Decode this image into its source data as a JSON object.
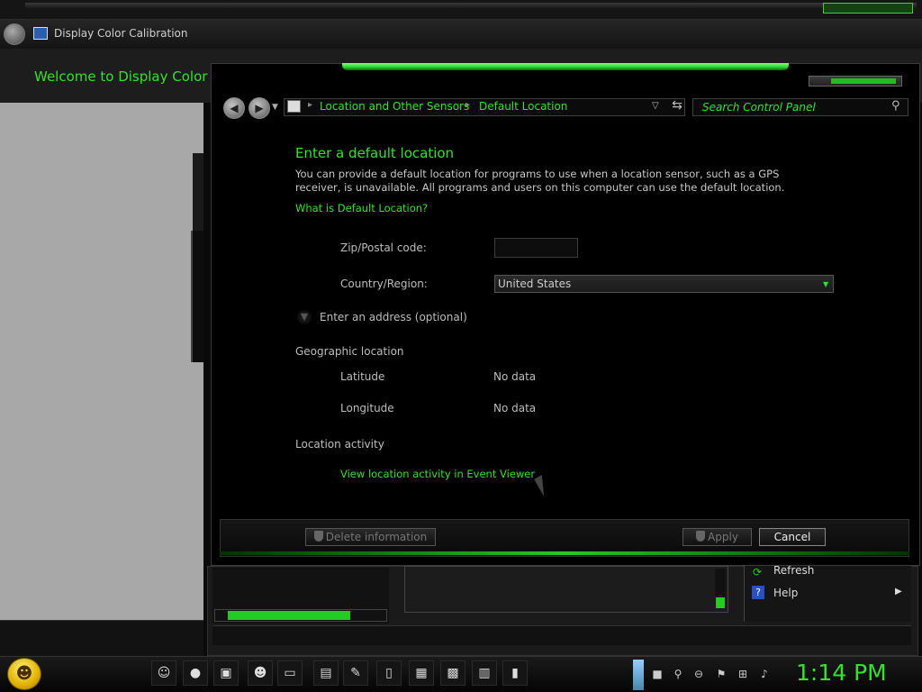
{
  "back_window": {
    "title": "Display Color Calibration",
    "welcome": "Welcome to Display Color Calibration"
  },
  "address_bar": {
    "crumbs": [
      "Location and Other Sensors",
      "Default Location"
    ],
    "search_placeholder": "Search Control Panel"
  },
  "content": {
    "heading": "Enter a default location",
    "description": "You can provide a default location for programs to use when a location sensor, such as a GPS receiver, is unavailable. All programs and users on this computer can use the default location.",
    "help_link": "What is Default Location?",
    "zip_label": "Zip/Postal code:",
    "zip_value": "",
    "country_label": "Country/Region:",
    "country_value": "United States",
    "expand_label": "Enter an address (optional)",
    "geo_heading": "Geographic location",
    "latitude_label": "Latitude",
    "latitude_value": "No data",
    "longitude_label": "Longitude",
    "longitude_value": "No data",
    "activity_heading": "Location activity",
    "activity_link": "View location activity in Event Viewer"
  },
  "footer": {
    "delete_label": "Delete information",
    "apply_label": "Apply",
    "cancel_label": "Cancel"
  },
  "background_menu": {
    "refresh": "Refresh",
    "help": "Help"
  },
  "taskbar": {
    "clock": "1:14 PM"
  },
  "colors": {
    "accent": "#36e02f",
    "background": "#000000"
  }
}
